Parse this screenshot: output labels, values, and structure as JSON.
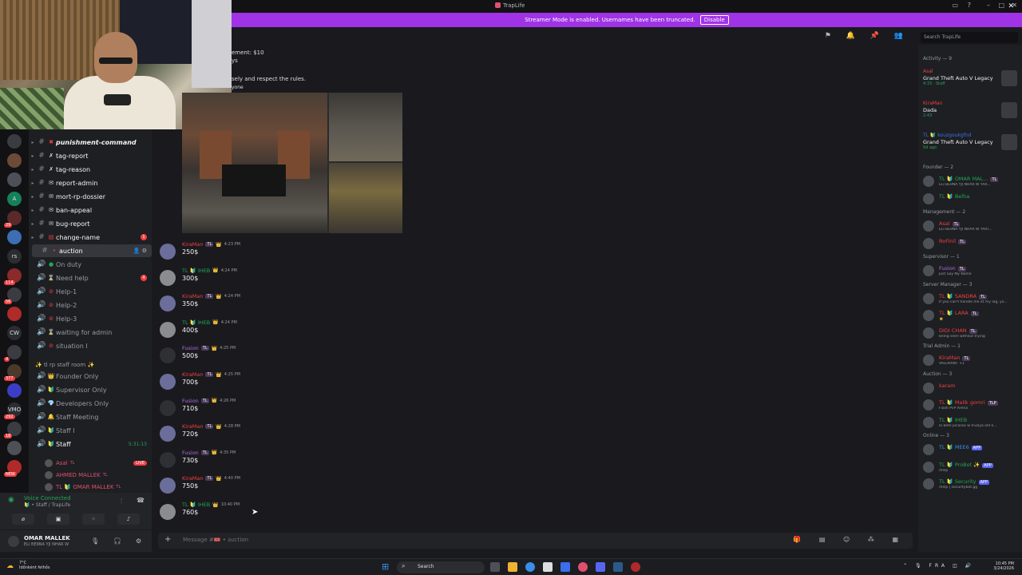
{
  "window": {
    "title": "TrapLife"
  },
  "banner": {
    "text": "Streamer Mode is enabled. Usernames have been truncated.",
    "disable_label": "Disable"
  },
  "rules_snippets": [
    "ement: $10",
    "ys",
    "sely and respect the rules.",
    "yone"
  ],
  "servers": [
    {
      "label": "",
      "color": "#3a3c42"
    },
    {
      "label": "",
      "color": "#6b4a37"
    },
    {
      "label": "",
      "color": "#4e5058"
    },
    {
      "label": "A",
      "color": "#14815a"
    },
    {
      "label": "",
      "color": "#5a2a2a",
      "badge": "29"
    },
    {
      "label": "",
      "color": "#3b6eb3"
    },
    {
      "label": "rs",
      "color": "#2b2d31"
    },
    {
      "label": "",
      "color": "#8a2a2a",
      "badge": "114"
    },
    {
      "label": "",
      "color": "#3a3c42",
      "badge": "56"
    },
    {
      "label": "",
      "color": "#b02a2a"
    },
    {
      "label": "CW",
      "color": "#2b2d31"
    },
    {
      "label": "",
      "color": "#3a3c42",
      "badge": "4"
    },
    {
      "label": "",
      "color": "#4a3a2a",
      "badge": "377"
    },
    {
      "label": "",
      "color": "#3b3ec4"
    },
    {
      "label": "VMO",
      "color": "#2b2d31",
      "badge": "292"
    },
    {
      "label": "",
      "color": "#3a3c42",
      "badge": "18"
    },
    {
      "label": "",
      "color": "#4e5058"
    },
    {
      "label": "",
      "color": "#b02a2a",
      "badge": "NEW"
    }
  ],
  "channels": [
    {
      "label": "punishment-command",
      "emoji": "✖",
      "emoji_color": "#f23f43",
      "arrow": true,
      "bold": true
    },
    {
      "label": "tag-report",
      "emoji": "✗",
      "emoji_color": "#dbdee1",
      "arrow": true,
      "bold": true
    },
    {
      "label": "tag-reason",
      "emoji": "✗",
      "emoji_color": "#dbdee1",
      "arrow": true,
      "bold": true
    },
    {
      "label": "report-admin",
      "emoji": "✉",
      "emoji_color": "#dbdee1",
      "arrow": true,
      "bold": true
    },
    {
      "label": "mort-rp-dossier",
      "emoji": "✉",
      "emoji_color": "#dbdee1",
      "arrow": true,
      "bold": true
    },
    {
      "label": "ban-appeal",
      "emoji": "✉",
      "emoji_color": "#dbdee1",
      "arrow": true,
      "bold": true
    },
    {
      "label": "bug-report",
      "emoji": "✉",
      "emoji_color": "#dbdee1",
      "arrow": true,
      "bold": true
    },
    {
      "label": "change-name",
      "emoji": "▤",
      "emoji_color": "#f23f43",
      "arrow": true,
      "bold": true,
      "ping": "1"
    },
    {
      "label": "auction",
      "emoji": "•",
      "emoji_color": "#f23f43",
      "active": true
    },
    {
      "label": "On duty",
      "emoji": "●",
      "emoji_color": "#23a55a",
      "voice": true
    },
    {
      "label": "Need help",
      "emoji": "⌛",
      "emoji_color": "#f0b232",
      "voice": true,
      "ping": "4"
    },
    {
      "label": "Help-1",
      "emoji": "⊘",
      "emoji_color": "#f23f43",
      "voice": true
    },
    {
      "label": "Help-2",
      "emoji": "⊘",
      "emoji_color": "#f23f43",
      "voice": true
    },
    {
      "label": "Help-3",
      "emoji": "⊘",
      "emoji_color": "#f23f43",
      "voice": true
    },
    {
      "label": "waiting for admin",
      "emoji": "⌛",
      "emoji_color": "#dbdee1",
      "voice": true
    },
    {
      "label": "situation I",
      "emoji": "⊘",
      "emoji_color": "#f23f43",
      "voice": true
    }
  ],
  "staff_category": "✨ tl rp staff room ✨",
  "staff_channels": [
    {
      "label": "Founder Only",
      "emoji": "👑",
      "emoji_color": "#f0b232"
    },
    {
      "label": "Supervisor Only",
      "emoji": "🔰",
      "emoji_color": "#23a55a"
    },
    {
      "label": "Developers Only",
      "emoji": "💎",
      "emoji_color": "#3b8eea"
    },
    {
      "label": "Staff Meeting",
      "emoji": "🔔",
      "emoji_color": "#f0b232"
    },
    {
      "label": "Staff I",
      "emoji": "🔰",
      "emoji_color": "#23a55a"
    },
    {
      "label": "Staff",
      "emoji": "🔰",
      "emoji_color": "#23a55a",
      "time": "5:31:13",
      "bold": true
    }
  ],
  "voice_users": [
    {
      "name": "Asal",
      "tag": "TL",
      "live": "LIVE"
    },
    {
      "name": "AHMED MALLEK",
      "tag": "TL"
    },
    {
      "name": "TL 🔰 OMAR MALLEK",
      "tag": "TL"
    }
  ],
  "voice_panel": {
    "status": "Voice Connected",
    "channel": "🔰 • Staff / TrapLife"
  },
  "user_panel": {
    "name": "OMAR MALLEK",
    "status": "ELI BE9NA YJI NHAR W"
  },
  "messages": [
    {
      "name": "KiraMan",
      "name_color": "#f23f43",
      "tag": "TL",
      "time": "4:23 PM",
      "body": "250$",
      "av": "purple"
    },
    {
      "name": "TL 🔰 IHEB",
      "name_color": "#23a55a",
      "tag": "",
      "time": "4:24 PM",
      "body": "300$",
      "av": "grey"
    },
    {
      "name": "KiraMan",
      "name_color": "#f23f43",
      "tag": "TL",
      "time": "4:24 PM",
      "body": "350$",
      "av": "purple"
    },
    {
      "name": "TL 🔰 IHEB",
      "name_color": "#23a55a",
      "tag": "",
      "time": "4:24 PM",
      "body": "400$",
      "av": "grey"
    },
    {
      "name": "Fusion",
      "name_color": "#b06be0",
      "tag": "TL",
      "time": "4:25 PM",
      "body": "500$",
      "av": "dark"
    },
    {
      "name": "KiraMan",
      "name_color": "#f23f43",
      "tag": "TL",
      "time": "4:25 PM",
      "body": "700$",
      "av": "purple"
    },
    {
      "name": "Fusion",
      "name_color": "#b06be0",
      "tag": "TL",
      "time": "4:26 PM",
      "body": "710$",
      "av": "dark"
    },
    {
      "name": "KiraMan",
      "name_color": "#f23f43",
      "tag": "TL",
      "time": "4:28 PM",
      "body": "720$",
      "av": "purple"
    },
    {
      "name": "Fusion",
      "name_color": "#b06be0",
      "tag": "TL",
      "time": "4:35 PM",
      "body": "730$",
      "av": "dark"
    },
    {
      "name": "KiraMan",
      "name_color": "#f23f43",
      "tag": "TL",
      "time": "4:40 PM",
      "body": "750$",
      "av": "purple"
    },
    {
      "name": "TL 🔰 IHEB",
      "name_color": "#23a55a",
      "tag": "",
      "time": "10:40 PM",
      "body": "760$",
      "av": "grey"
    }
  ],
  "composer": {
    "placeholder": "Message #🎟️ • auction"
  },
  "members": {
    "search_placeholder": "Search TrapLife",
    "activity_header": "Activity — 9",
    "activities": [
      {
        "name": "Asal",
        "name_color": "#f23f43",
        "game": "Grand Theft Auto V Legacy",
        "detail": "4:33 · Staff"
      },
      {
        "name": "KiraMan",
        "name_color": "#f23f43",
        "game": "Dada",
        "detail": "2:43"
      },
      {
        "name": "TL 🔰 kouzgoukgfnd",
        "name_color": "#3b6eea",
        "game": "Grand Theft Auto V Legacy",
        "detail": "5d ago"
      }
    ],
    "groups": [
      {
        "header": "Founder — 2",
        "members": [
          {
            "name": "TL 🔰 OMAR MAL...",
            "name_color": "#23a55a",
            "tag": "TL",
            "sub": "ELI BE9NA YJI NHAR W YAR..."
          },
          {
            "name": "TL 🔰 Belha",
            "name_color": "#23a55a",
            "tag": "",
            "sub": ""
          }
        ]
      },
      {
        "header": "Management — 2",
        "members": [
          {
            "name": "Asal",
            "name_color": "#f23f43",
            "tag": "TL",
            "sub": "ELI BE9NA YJI NHAR W YART..."
          },
          {
            "name": "RoFinil",
            "name_color": "#f23f43",
            "tag": "TL",
            "sub": ""
          }
        ]
      },
      {
        "header": "Supervisor — 1",
        "members": [
          {
            "name": "Fusion",
            "name_color": "#b06be0",
            "tag": "TL",
            "sub": "Just Say My Name"
          }
        ]
      },
      {
        "header": "Server Manager — 3",
        "members": [
          {
            "name": "TL 🔰 SANDRA",
            "name_color": "#f23f43",
            "tag": "TL",
            "sub": "If you can't handle me at my lag, yo..."
          },
          {
            "name": "TL 🔰 LARA",
            "name_color": "#f23f43",
            "tag": "TL",
            "sub": "🔒"
          },
          {
            "name": "DIDI CHAN",
            "name_color": "#f23f43",
            "tag": "TL",
            "sub": "being seen without trying"
          }
        ]
      },
      {
        "header": "Trial Admin — 1",
        "members": [
          {
            "name": "KiraMan",
            "name_color": "#f23f43",
            "tag": "TL",
            "sub": "VALORANT +1"
          }
        ]
      },
      {
        "header": "Auction — 3",
        "members": [
          {
            "name": "karam",
            "name_color": "#f23f43",
            "tag": "",
            "sub": ""
          },
          {
            "name": "TL 🔰 Malik gomri",
            "name_color": "#f23f43",
            "tag": "TLP",
            "sub": "Flash PvP Arena"
          },
          {
            "name": "TL 🔰 IHEB",
            "name_color": "#23a55a",
            "tag": "",
            "sub": "la bete picasso w m3aya old e..."
          }
        ]
      },
      {
        "header": "Online — 3",
        "members": [
          {
            "name": "TL 🔰 MEE6",
            "name_color": "#3b8eea",
            "tag": "APP",
            "sub": ""
          },
          {
            "name": "TL 🔰 ProBot ✨",
            "name_color": "#23a55a",
            "tag": "APP",
            "sub": "/help"
          },
          {
            "name": "TL 🔰 Security",
            "name_color": "#23a55a",
            "tag": "APP",
            "sub": "/help | securitybot.gg"
          }
        ]
      }
    ]
  },
  "taskbar": {
    "weather_temp": "7°C",
    "weather_desc": "Időnként felhős",
    "search": "Search",
    "lang": "FRA",
    "time": "10:45 PM",
    "date": "3/24/2026"
  }
}
